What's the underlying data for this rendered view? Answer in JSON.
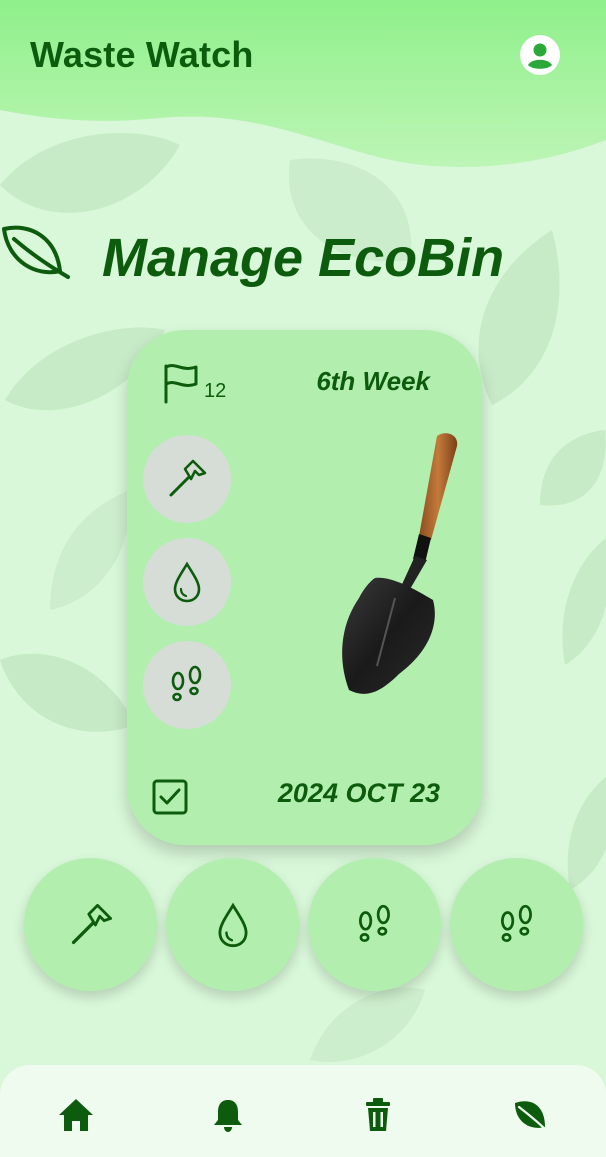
{
  "header": {
    "app_title": "Waste Watch",
    "profile_icon": "account-circle-icon"
  },
  "heading": {
    "title": "Manage EcoBin",
    "icon": "leaf-icon"
  },
  "card": {
    "flag_icon": "flag-icon",
    "flag_count": "12",
    "week": "6th Week",
    "tools": [
      {
        "icon": "hammer-icon"
      },
      {
        "icon": "water-drop-icon"
      },
      {
        "icon": "footprints-icon"
      }
    ],
    "image": "shovel-image",
    "check_icon": "checkbox-checked-icon",
    "date": "2024 OCT 23"
  },
  "quick_actions": [
    {
      "icon": "hammer-icon"
    },
    {
      "icon": "water-drop-icon"
    },
    {
      "icon": "footprints-icon"
    },
    {
      "icon": "footprints-icon"
    }
  ],
  "nav": [
    {
      "icon": "home-icon"
    },
    {
      "icon": "bell-icon"
    },
    {
      "icon": "trash-icon"
    },
    {
      "icon": "leaf-icon"
    }
  ],
  "colors": {
    "primary": "#0d5c0d",
    "card_bg": "#b2efaf",
    "tool_bg": "#d6ddd7",
    "page_bg": "#d9f7d9"
  }
}
